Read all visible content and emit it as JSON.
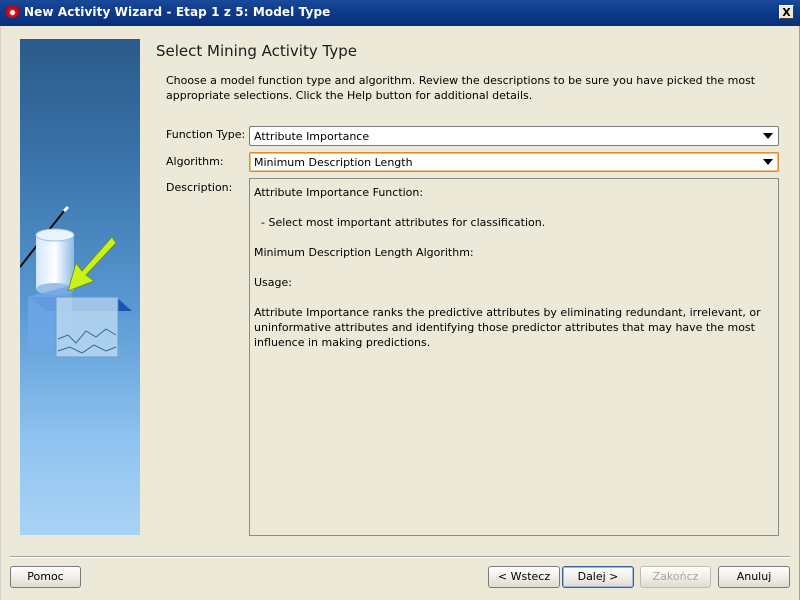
{
  "window": {
    "title": "New Activity Wizard - Etap 1 z 5: Model Type",
    "close_label": "X"
  },
  "page": {
    "heading": "Select Mining Activity Type",
    "intro": "Choose a model function type and algorithm.  Review the descriptions to be sure you have picked the most appropriate selections. Click the Help button for additional details."
  },
  "form": {
    "function_type_label": "Function Type:",
    "function_type_value": "Attribute Importance",
    "algorithm_label": "Algorithm:",
    "algorithm_value": "Minimum Description Length",
    "description_label": "Description:",
    "description_lines": [
      "Attribute Importance Function:",
      "  - Select most important attributes for classification.",
      "Minimum Description Length Algorithm:",
      "Usage:",
      "Attribute Importance ranks the predictive attributes by eliminating redundant, irrelevant, or uninformative attributes and identifying those predictor attributes that may have the most influence in making predictions."
    ]
  },
  "buttons": {
    "help": "Pomoc",
    "back": "< Wstecz",
    "next": "Dalej >",
    "finish": "Zakończ",
    "cancel": "Anuluj"
  }
}
